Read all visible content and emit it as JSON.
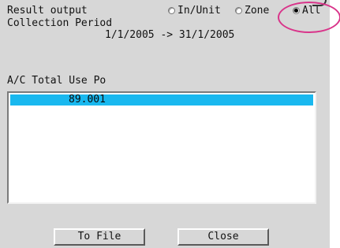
{
  "header": {
    "result_output_label": "Result output",
    "collection_period_label": "Collection Period",
    "period_value": "1/1/2005 -> 31/1/2005"
  },
  "result_output_options": [
    {
      "label": "In/Unit",
      "selected": false
    },
    {
      "label": "Zone",
      "selected": false
    },
    {
      "label": "All",
      "selected": true
    }
  ],
  "list": {
    "header_label": "A/C Total Use Po",
    "rows": [
      {
        "value": "89.001",
        "selected": true
      }
    ]
  },
  "buttons": {
    "to_file_label": "To File",
    "close_label": "Close"
  },
  "colors": {
    "panel_bg": "#d7d7d7",
    "selection": "#19b8ef",
    "annotation_ring": "#d9348a"
  }
}
